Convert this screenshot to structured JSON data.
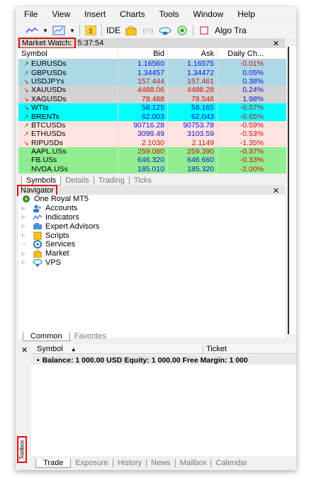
{
  "menu": [
    "File",
    "View",
    "Insert",
    "Charts",
    "Tools",
    "Window",
    "Help"
  ],
  "toolbar": {
    "ide_label": "IDE",
    "algo_label": "Algo Tra"
  },
  "market_watch": {
    "title": "Market Watch:",
    "time": "5:37:54",
    "columns": [
      "Symbol",
      "Bid",
      "Ask",
      "Daily Ch..."
    ],
    "rows": [
      {
        "symbol": "EURUSDs",
        "bid": "1.16560",
        "ask": "1.16575",
        "change": "-0.01%",
        "dir": "up",
        "bg": "#add8e6",
        "bidColor": "#1010e0",
        "askColor": "#1010e0",
        "chgColor": "#d01010"
      },
      {
        "symbol": "GBPUSDs",
        "bid": "1.34457",
        "ask": "1.34472",
        "change": "0.05%",
        "dir": "up",
        "bg": "#add8e6",
        "bidColor": "#1010e0",
        "askColor": "#1010e0",
        "chgColor": "#1010e0"
      },
      {
        "symbol": "USDJPYs",
        "bid": "157.444",
        "ask": "157.461",
        "change": "0.38%",
        "dir": "down",
        "bg": "#add8e6",
        "bidColor": "#d01010",
        "askColor": "#d01010",
        "chgColor": "#1010e0"
      },
      {
        "symbol": "XAUUSDs",
        "bid": "4488.06",
        "ask": "4488.28",
        "change": "0.24%",
        "dir": "down",
        "bg": "#d3d3d3",
        "bidColor": "#d01010",
        "askColor": "#d01010",
        "chgColor": "#1010e0"
      },
      {
        "symbol": "XAGUSDs",
        "bid": "78.488",
        "ask": "78.546",
        "change": "1.98%",
        "dir": "down",
        "bg": "#d3d3d3",
        "bidColor": "#d01010",
        "askColor": "#d01010",
        "chgColor": "#1010e0"
      },
      {
        "symbol": "WTIs",
        "bid": "58.125",
        "ask": "58.165",
        "change": "-0.57%",
        "dir": "down",
        "bg": "#00ffff",
        "bidColor": "#1010e0",
        "askColor": "#1010e0",
        "chgColor": "#d01010"
      },
      {
        "symbol": "BRENTs",
        "bid": "62.003",
        "ask": "62.043",
        "change": "-0.65%",
        "dir": "up",
        "bg": "#00ffff",
        "bidColor": "#1010e0",
        "askColor": "#1010e0",
        "chgColor": "#d01010"
      },
      {
        "symbol": "BTCUSDs",
        "bid": "90716.28",
        "ask": "90753.78",
        "change": "-0.59%",
        "dir": "up",
        "bg": "#ffe4e1",
        "bidColor": "#1010e0",
        "askColor": "#1010e0",
        "chgColor": "#d01010"
      },
      {
        "symbol": "ETHUSDs",
        "bid": "3099.49",
        "ask": "3103.59",
        "change": "-0.53%",
        "dir": "up",
        "bg": "#ffe4e1",
        "bidColor": "#1010e0",
        "askColor": "#1010e0",
        "chgColor": "#d01010"
      },
      {
        "symbol": "RIPUSDs",
        "bid": "2.1030",
        "ask": "2.1149",
        "change": "-1.35%",
        "dir": "down",
        "bg": "#ffe4e1",
        "bidColor": "#d01010",
        "askColor": "#d01010",
        "chgColor": "#d01010"
      },
      {
        "symbol": "AAPL.USs",
        "bid": "259.080",
        "ask": "259.390",
        "change": "-0.37%",
        "dir": "neutral",
        "bg": "#90ee90",
        "bidColor": "#d01010",
        "askColor": "#d01010",
        "chgColor": "#d01010"
      },
      {
        "symbol": "FB.USs",
        "bid": "646.320",
        "ask": "646.660",
        "change": "-0.33%",
        "dir": "neutral",
        "bg": "#90ee90",
        "bidColor": "#1010e0",
        "askColor": "#1010e0",
        "chgColor": "#d01010"
      },
      {
        "symbol": "NVDA.USs",
        "bid": "185.010",
        "ask": "185.320",
        "change": "-2.00%",
        "dir": "neutral",
        "bg": "#90ee90",
        "bidColor": "#1010e0",
        "askColor": "#1010e0",
        "chgColor": "#d01010"
      }
    ],
    "tabs": [
      "Symbols",
      "Details",
      "Trading",
      "Ticks"
    ]
  },
  "navigator": {
    "title": "Navigator",
    "root": "One Royal MT5",
    "items": [
      {
        "label": "Accounts",
        "icon": "accounts-icon"
      },
      {
        "label": "Indicators",
        "icon": "indicators-icon"
      },
      {
        "label": "Expert Advisors",
        "icon": "expert-advisors-icon"
      },
      {
        "label": "Scripts",
        "icon": "scripts-icon"
      },
      {
        "label": "Services",
        "icon": "services-icon"
      },
      {
        "label": "Market",
        "icon": "market-icon"
      },
      {
        "label": "VPS",
        "icon": "vps-icon"
      }
    ],
    "tabs": [
      "Common",
      "Favorites"
    ]
  },
  "toolbox": {
    "vertical_label": "Toolbox",
    "columns": [
      "Symbol",
      "Ticket"
    ],
    "sort_glyph": "▲",
    "summary": "Balance: 1 000.00 USD  Equity: 1 000.00  Free Margin: 1 000",
    "tabs": [
      "Trade",
      "Exposure",
      "History",
      "News",
      "Mailbox",
      "Calendar"
    ]
  },
  "colors": {
    "highlight_red": "#e01010",
    "up_green": "#0a8a0a",
    "down_red": "#d01010"
  }
}
